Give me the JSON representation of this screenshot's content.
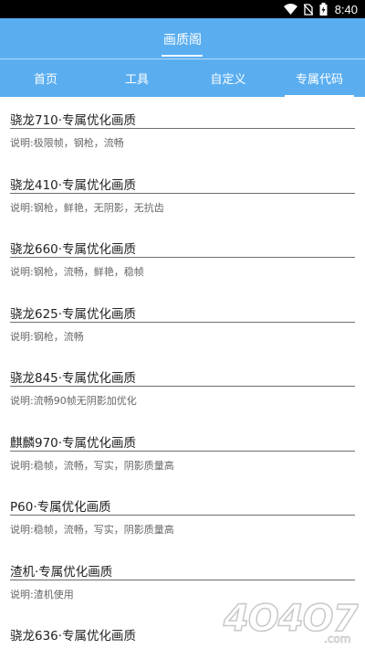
{
  "status_bar": {
    "time": "8:40",
    "icons": [
      "wifi-icon",
      "no-sim-icon",
      "battery-icon"
    ]
  },
  "header": {
    "title": "画质阁"
  },
  "tabs": [
    {
      "label": "首页",
      "selected": false
    },
    {
      "label": "工具",
      "selected": false
    },
    {
      "label": "自定义",
      "selected": false
    },
    {
      "label": "专属代码",
      "selected": true
    }
  ],
  "items": [
    {
      "title": "骁龙710·专属优化画质",
      "desc": "说明:极限帧，钢枪，流畅"
    },
    {
      "title": "骁龙410·专属优化画质",
      "desc": "说明:钢枪，鲜艳，无阴影，无抗齿"
    },
    {
      "title": "骁龙660·专属优化画质",
      "desc": "说明:钢枪，流畅，鲜艳，稳帧"
    },
    {
      "title": "骁龙625·专属优化画质",
      "desc": "说明:钢枪，流畅"
    },
    {
      "title": "骁龙845·专属优化画质",
      "desc": "说明:流畅90帧无阴影加优化"
    },
    {
      "title": "麒麟970·专属优化画质",
      "desc": "说明:稳帧，流畅，写实，阴影质量高"
    },
    {
      "title": "P60·专属优化画质",
      "desc": "说明:稳帧，流畅，写实，阴影质量高"
    },
    {
      "title": "渣机·专属优化画质",
      "desc": "说明:渣机使用"
    },
    {
      "title": "骁龙636·专属优化画质",
      "desc": ""
    }
  ],
  "watermark": {
    "text": "4O4O7",
    "suffix": ".com"
  },
  "colors": {
    "header_bg": "#5aaef0",
    "status_bg": "#000000",
    "title_text": "#222222",
    "desc_text": "#666666"
  }
}
